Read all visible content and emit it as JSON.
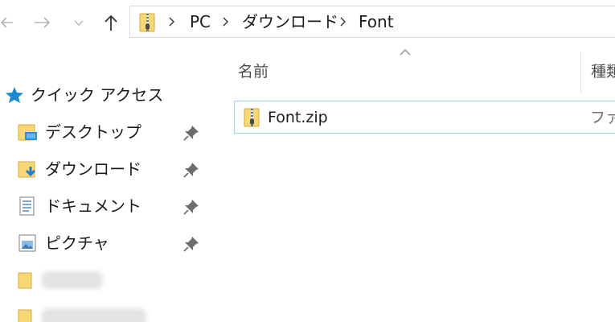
{
  "navigation": {
    "back_icon": "arrow-left-icon",
    "forward_icon": "arrow-right-icon",
    "recent_icon": "chevron-down-icon",
    "up_icon": "arrow-up-icon"
  },
  "address_bar": {
    "icon": "zip-folder-icon",
    "breadcrumbs": [
      "PC",
      "ダウンロード",
      "Font"
    ]
  },
  "nav_pane": {
    "quick_access": {
      "label": "クイック アクセス",
      "icon": "star-icon"
    },
    "items": [
      {
        "label": "デスクトップ",
        "icon": "desktop-folder-icon",
        "pinned": true
      },
      {
        "label": "ダウンロード",
        "icon": "downloads-folder-icon",
        "pinned": true
      },
      {
        "label": "ドキュメント",
        "icon": "documents-icon",
        "pinned": true
      },
      {
        "label": "ピクチャ",
        "icon": "pictures-icon",
        "pinned": true
      }
    ],
    "redacted_items": 2
  },
  "file_list": {
    "columns": {
      "name": "名前",
      "type": "種類"
    },
    "sort_indicator": "sort-ascending-icon",
    "files": [
      {
        "name": "Font.zip",
        "type": "ファ",
        "icon": "zip-folder-icon"
      }
    ]
  },
  "colors": {
    "accent": "#0078d7",
    "selection_border": "#99d1ff",
    "folder_yellow": "#f8d775",
    "star_blue": "#1a8ad4"
  }
}
